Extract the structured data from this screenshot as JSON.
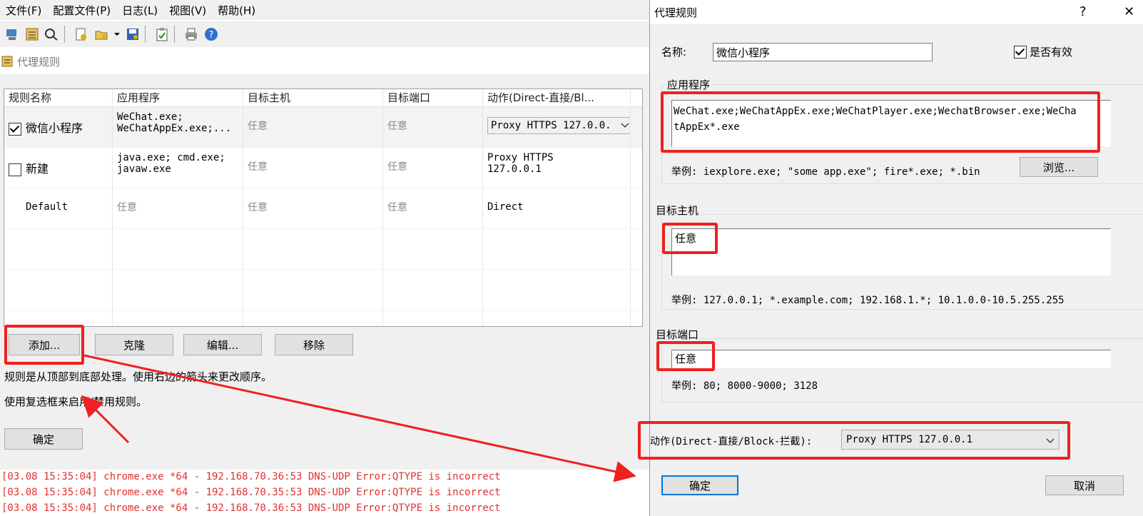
{
  "menu": {
    "items": [
      "文件(F)",
      "配置文件(P)",
      "日志(L)",
      "视图(V)",
      "帮助(H)"
    ]
  },
  "toolbar": {
    "icons": [
      "proxy-servers-icon",
      "rules-icon",
      "dns-icon",
      "settings-icon",
      "open-profile-icon",
      "save-profile-icon",
      "clipboard-icon",
      "print-icon",
      "help-icon"
    ]
  },
  "rules_panel": {
    "title": "代理规则",
    "columns": [
      "规则名称",
      "应用程序",
      "目标主机",
      "目标端口",
      "动作(Direct-直接/Bl..."
    ],
    "rows": [
      {
        "checked": true,
        "name": "微信小程序",
        "apps_line1": "WeChat.exe;",
        "apps_line2": "WeChatAppEx.exe;...",
        "host": "任意",
        "port": "任意",
        "action": "Proxy HTTPS 127.0.0."
      },
      {
        "checked": false,
        "name": "新建",
        "apps_line1": "java.exe; cmd.exe;",
        "apps_line2": "javaw.exe",
        "host": "任意",
        "port": "任意",
        "action_line1": "Proxy HTTPS",
        "action_line2": "127.0.0.1"
      },
      {
        "name": "Default",
        "apps": "任意",
        "host": "任意",
        "port": "任意",
        "action": "Direct"
      }
    ],
    "buttons": {
      "add": "添加...",
      "clone": "克隆",
      "edit": "编辑...",
      "remove": "移除"
    },
    "note1": "规则是从顶部到底部处理。使用右边的箭头来更改顺序。",
    "note2": "使用复选框来启用/禁用规则。",
    "ok": "确定"
  },
  "log": {
    "lines": [
      "[03.08 15:35:04] chrome.exe *64 - 192.168.70.36:53 DNS-UDP Error:QTYPE is incorrect",
      "[03.08 15:35:04] chrome.exe *64 - 192.168.70.35:53 DNS-UDP Error:QTYPE is incorrect",
      "[03.08 15:35:04] chrome.exe *64 - 192.168.70.36:53 DNS-UDP Error:QTYPE is incorrect"
    ]
  },
  "dialog": {
    "title": "代理规则",
    "help": "?",
    "close": "✕",
    "name_label": "名称:",
    "name_value": "微信小程序",
    "enabled_label": "是否有效",
    "apps_group": "应用程序",
    "apps_value_line1": "WeChat.exe;WeChatAppEx.exe;WeChatPlayer.exe;WechatBrowser.exe;WeCha",
    "apps_value_line2": "tAppEx*.exe",
    "apps_example": "举例: iexplore.exe; \"some app.exe\"; fire*.exe; *.bin",
    "browse": "浏览...",
    "host_group": "目标主机",
    "host_value": "任意",
    "host_example": "举例: 127.0.0.1; *.example.com; 192.168.1.*; 10.1.0.0-10.5.255.255",
    "port_group": "目标端口",
    "port_value": "任意",
    "port_example": "举例: 80; 8000-9000; 3128",
    "action_label": "动作(Direct-直接/Block-拦截):",
    "action_value": "Proxy HTTPS 127.0.0.1",
    "ok": "确定",
    "cancel": "取消"
  },
  "colors": {
    "annotation": "#f02020",
    "log_text": "#e03030",
    "window_bg": "#f0f0f0"
  }
}
